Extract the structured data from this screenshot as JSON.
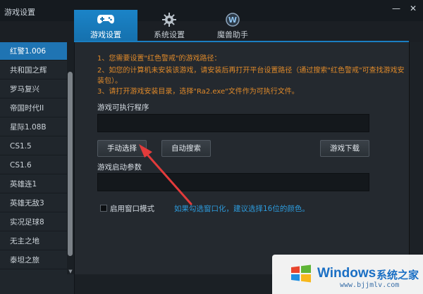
{
  "window": {
    "title": "游戏设置",
    "minimize_glyph": "—",
    "close_glyph": "✕"
  },
  "tabs": [
    {
      "label": "游戏设置",
      "icon": "gamepad-icon",
      "active": true
    },
    {
      "label": "系统设置",
      "icon": "gear-icon",
      "active": false
    },
    {
      "label": "魔兽助手",
      "icon": "warcraft-logo-icon",
      "active": false
    }
  ],
  "sidebar": {
    "items": [
      {
        "label": "红警1.006",
        "active": true
      },
      {
        "label": "共和国之辉"
      },
      {
        "label": "罗马复兴"
      },
      {
        "label": "帝国时代II"
      },
      {
        "label": "星际1.08B"
      },
      {
        "label": "CS1.5"
      },
      {
        "label": "CS1.6"
      },
      {
        "label": "英雄连1"
      },
      {
        "label": "英雄无敌3"
      },
      {
        "label": "实况足球8"
      },
      {
        "label": "无主之地"
      },
      {
        "label": "泰坦之旅"
      }
    ]
  },
  "main": {
    "notes": [
      "1、您需要设置\"红色警戒\"的游戏路径：",
      "2、如您的计算机未安装该游戏，请安装后再打开平台设置路径（通过搜索\"红色警戒\"可查找游戏安",
      "装包）。",
      "3、请打开游戏安装目录，选择\"Ra2.exe\"文件作为可执行文件。"
    ],
    "exe_label": "游戏可执行程序",
    "exe_value": "",
    "buttons": {
      "manual": "手动选择",
      "auto": "自动搜索",
      "download": "游戏下载"
    },
    "params_label": "游戏启动参数",
    "params_value": "",
    "windowed_label": "启用窗口模式",
    "windowed_checked": false,
    "hint": "如果勾选窗口化，建议选择16位的颜色。"
  },
  "watermark": {
    "brand": "Windows",
    "cn": "系统之家",
    "url": "www.bjjmlv.com"
  },
  "colors": {
    "accent": "#1b84c8",
    "note": "#e08a2a",
    "hint": "#2d9bdc",
    "arrow": "#e23b3b"
  }
}
